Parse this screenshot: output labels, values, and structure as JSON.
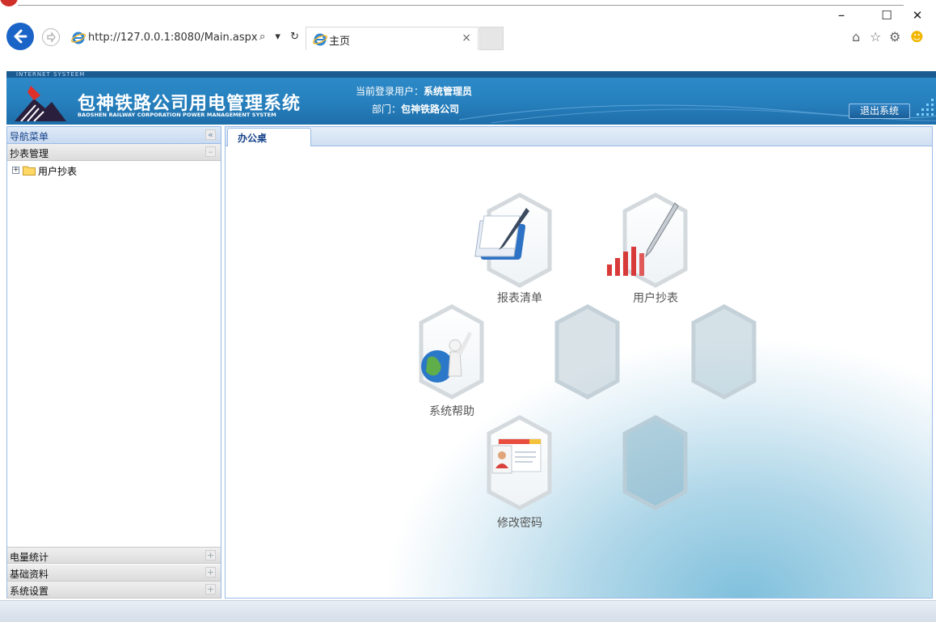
{
  "browser": {
    "url": "http://127.0.0.1:8080/Main.aspx",
    "address_tools": "⌕ ▾ ↻",
    "tab_title": "主页",
    "tab_close": "×",
    "window_minimize": "–",
    "window_maximize": "☐",
    "window_close": "✕"
  },
  "header": {
    "badge": "INTERNET SYSTEEM",
    "title": "包神铁路公司用电管理系统",
    "subtitle": "BAOSHEN RAILWAY CORPORATION POWER MANAGEMENT SYSTEM",
    "user_label": "当前登录用户：",
    "user_value": "系统管理员",
    "dept_label": "部门：",
    "dept_value": "包神铁路公司",
    "logout_label": "退出系统"
  },
  "sidebar": {
    "nav_title": "导航菜单",
    "nav_collapse": "«",
    "sections": [
      {
        "label": "抄表管理",
        "toggle": "–"
      },
      {
        "label": "电量统计",
        "toggle": "+"
      },
      {
        "label": "基础资料",
        "toggle": "+"
      },
      {
        "label": "系统设置",
        "toggle": "+"
      }
    ],
    "tree": [
      {
        "label": "用户抄表",
        "expander": "+"
      }
    ]
  },
  "main": {
    "tab_label": "办公桌",
    "tiles": [
      {
        "label": "报表清单",
        "icon": "report-list-icon"
      },
      {
        "label": "用户抄表",
        "icon": "meter-reading-icon"
      },
      {
        "label": "系统帮助",
        "icon": "system-help-icon"
      },
      {
        "label": "修改密码",
        "icon": "change-password-icon"
      }
    ]
  },
  "colors": {
    "header_blue": "#2781bf",
    "panel_border": "#99bbe8",
    "tab_text": "#15428b"
  }
}
